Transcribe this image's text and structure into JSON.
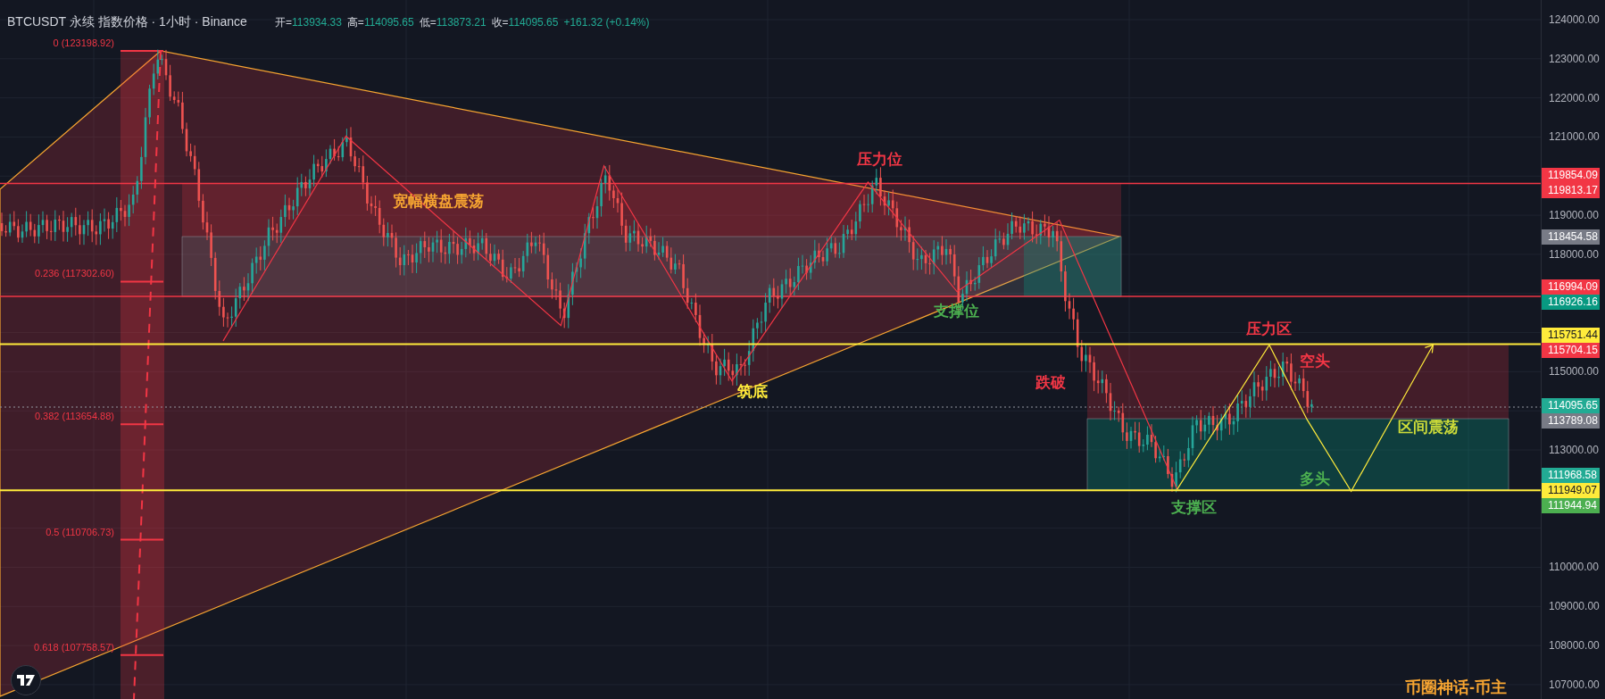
{
  "header": {
    "title": "BTCUSDT 永续 指数价格 · 1小时 · Binance",
    "ohlc": [
      {
        "label": "开=",
        "value": "113934.33"
      },
      {
        "label": "高=",
        "value": "114095.65"
      },
      {
        "label": "低=",
        "value": "113873.21"
      },
      {
        "label": "收=",
        "value": "114095.65"
      }
    ],
    "change": "+161.32 (+0.14%)"
  },
  "fib_levels": [
    {
      "label": "0 (123198.92)"
    },
    {
      "label": "0.236 (117302.60)"
    },
    {
      "label": "0.382 (113654.88)"
    },
    {
      "label": "0.5 (110706.73)"
    },
    {
      "label": "0.618 (107758.57)"
    }
  ],
  "annotations": [
    {
      "text": "宽幅横盘震荡",
      "color": "#f7a531"
    },
    {
      "text": "压力位",
      "color": "#f23645"
    },
    {
      "text": "支撑位",
      "color": "#4caf50"
    },
    {
      "text": "筑底",
      "color": "#ffeb3b"
    },
    {
      "text": "跌破",
      "color": "#f23645"
    },
    {
      "text": "压力区",
      "color": "#f23645"
    },
    {
      "text": "空头",
      "color": "#f23645"
    },
    {
      "text": "区间震荡",
      "color": "#cddc39"
    },
    {
      "text": "多头",
      "color": "#4caf50"
    },
    {
      "text": "支撑区",
      "color": "#4caf50"
    }
  ],
  "signature": "币圈神话-币主",
  "price_axis": {
    "ticks": [
      "124000.00",
      "123000.00",
      "122000.00",
      "121000.00",
      "119000.00",
      "118000.00",
      "115000.00",
      "113000.00",
      "110000.00",
      "109000.00",
      "108000.00",
      "107000.00"
    ],
    "badges": [
      {
        "text": "119854.09",
        "color": "#f23645"
      },
      {
        "text": "119813.17",
        "color": "#f23645"
      },
      {
        "text": "118454.58",
        "color": "#787b86"
      },
      {
        "text": "116994.09",
        "color": "#f23645"
      },
      {
        "text": "116926.16",
        "color": "#089981"
      },
      {
        "text": "115751.44",
        "color": "#ffeb3b"
      },
      {
        "text": "115704.15",
        "color": "#f23645"
      },
      {
        "text": "114095.65",
        "color": "#22ab94"
      },
      {
        "text": "113789.08",
        "color": "#787b86"
      },
      {
        "text": "111968.58",
        "color": "#22ab94"
      },
      {
        "text": "111949.07",
        "color": "#ffeb3b"
      },
      {
        "text": "111944.94",
        "color": "#4caf50"
      }
    ]
  }
}
